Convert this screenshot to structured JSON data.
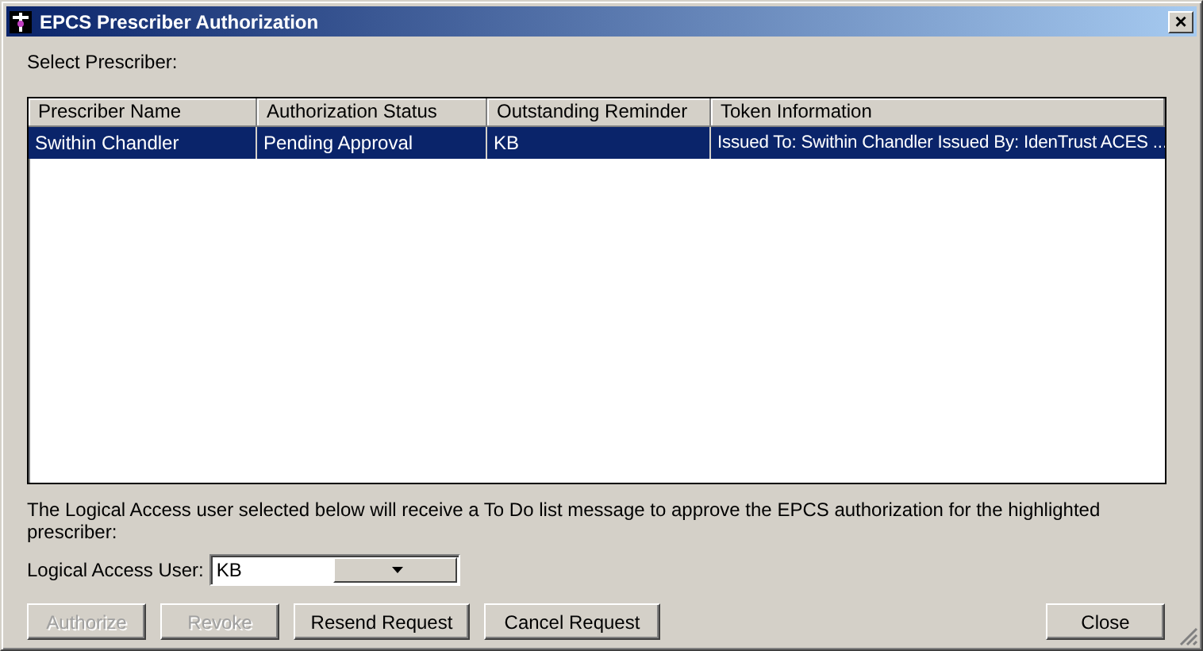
{
  "window": {
    "title": "EPCS Prescriber Authorization",
    "close": "×"
  },
  "select_label": "Select Prescriber:",
  "table": {
    "columns": [
      "Prescriber Name",
      "Authorization Status",
      "Outstanding Reminder",
      "Token Information"
    ],
    "rows": [
      {
        "selected": true,
        "cells": [
          "Swithin Chandler",
          "Pending Approval",
          "KB",
          "Issued To: Swithin Chandler Issued By: IdenTrust ACES ..."
        ]
      }
    ]
  },
  "instruction": "The Logical Access user selected below will receive a To Do list message to approve the EPCS authorization for the highlighted prescriber:",
  "logical_access_user": {
    "label": "Logical Access User:",
    "value": "KB"
  },
  "buttons": [
    {
      "label": "Authorize",
      "disabled": true
    },
    {
      "label": "Revoke",
      "disabled": true
    },
    {
      "label": "Resend Request",
      "disabled": false
    },
    {
      "label": "Cancel Request",
      "disabled": false
    }
  ],
  "close_button": {
    "label": "Close",
    "disabled": false
  }
}
